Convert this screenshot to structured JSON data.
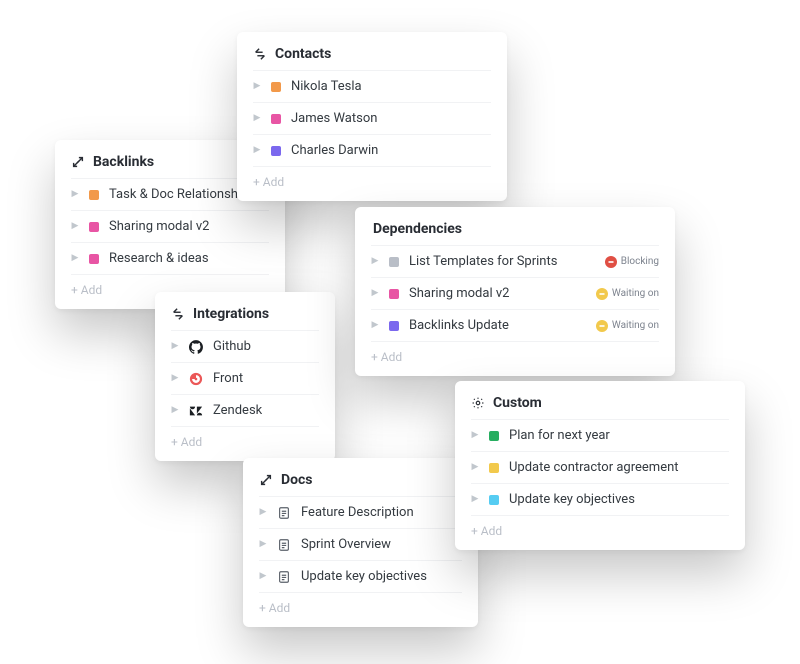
{
  "common": {
    "add": "+ Add"
  },
  "colors": {
    "orange": "#f2994a",
    "pink": "#e855a4",
    "purple": "#7b68ee",
    "grey": "#b9bec7",
    "green": "#27ae60",
    "yellow": "#f2c94c",
    "sky": "#56ccf2"
  },
  "cards": {
    "backlinks": {
      "title": "Backlinks",
      "items": [
        {
          "label": "Task & Doc Relationships",
          "color": "orange"
        },
        {
          "label": "Sharing modal v2",
          "color": "pink"
        },
        {
          "label": "Research & ideas",
          "color": "pink"
        }
      ]
    },
    "contacts": {
      "title": "Contacts",
      "items": [
        {
          "label": "Nikola Tesla",
          "color": "orange"
        },
        {
          "label": "James Watson",
          "color": "pink"
        },
        {
          "label": "Charles Darwin",
          "color": "purple"
        }
      ]
    },
    "integrations": {
      "title": "Integrations",
      "items": [
        {
          "label": "Github",
          "brand": "github"
        },
        {
          "label": "Front",
          "brand": "front"
        },
        {
          "label": "Zendesk",
          "brand": "zendesk"
        }
      ]
    },
    "dependencies": {
      "title": "Dependencies",
      "items": [
        {
          "label": "List Templates for Sprints",
          "color": "grey",
          "status": "blocking"
        },
        {
          "label": "Sharing modal v2",
          "color": "pink",
          "status": "waiting"
        },
        {
          "label": "Backlinks Update",
          "color": "purple",
          "status": "waiting"
        }
      ],
      "statusLabels": {
        "blocking": "Blocking",
        "waiting": "Waiting on"
      }
    },
    "docs": {
      "title": "Docs",
      "items": [
        {
          "label": "Feature Description"
        },
        {
          "label": "Sprint Overview"
        },
        {
          "label": "Update key objectives"
        }
      ]
    },
    "custom": {
      "title": "Custom",
      "items": [
        {
          "label": "Plan for next year",
          "color": "green"
        },
        {
          "label": "Update contractor agreement",
          "color": "yellow"
        },
        {
          "label": "Update key objectives",
          "color": "sky"
        }
      ]
    }
  }
}
